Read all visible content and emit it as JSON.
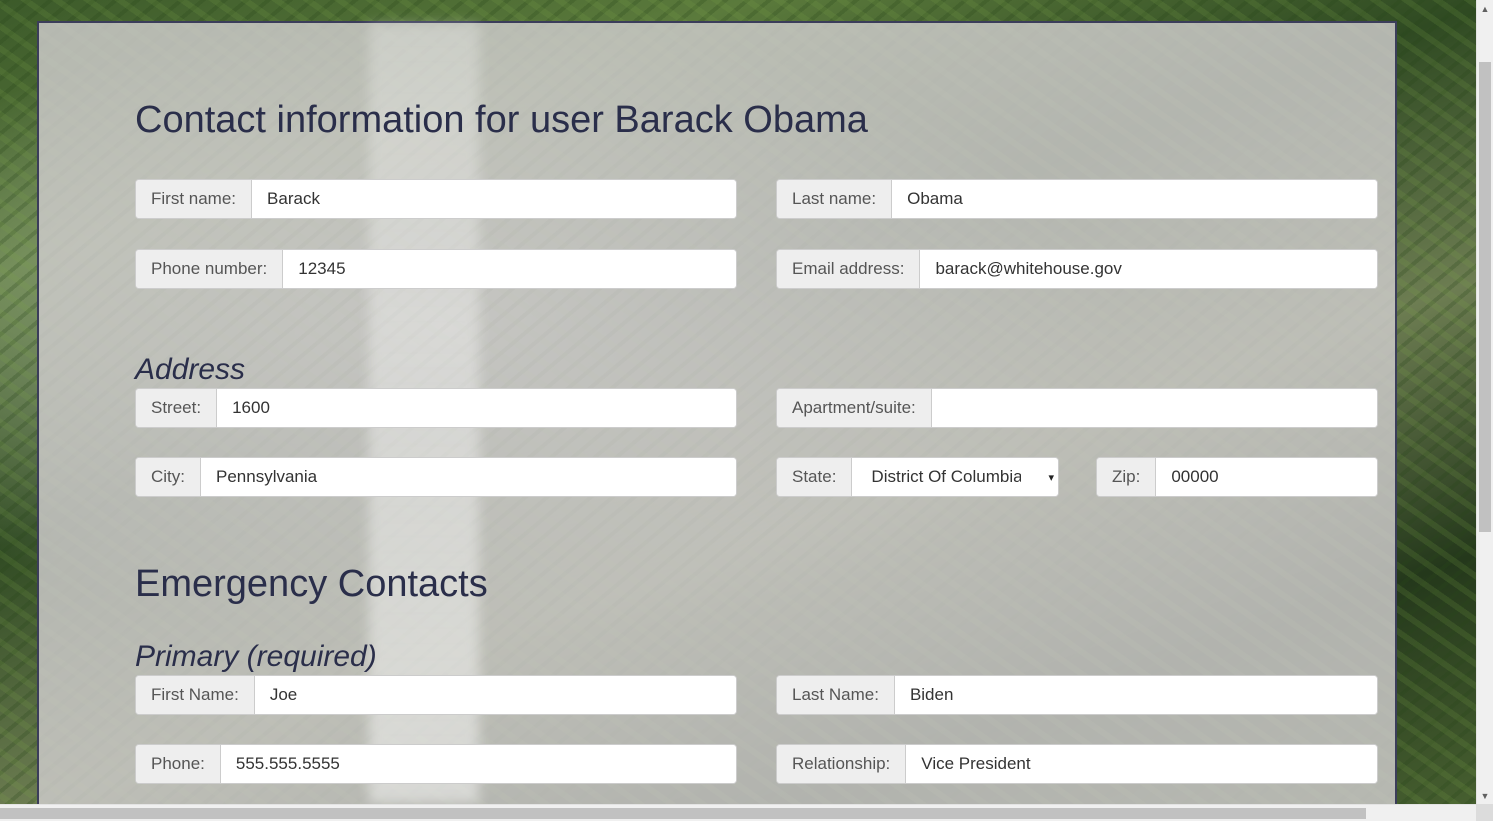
{
  "page": {
    "title": "Contact information for user Barack Obama"
  },
  "contact": {
    "first_name_label": "First name:",
    "first_name_value": "Barack",
    "last_name_label": "Last name:",
    "last_name_value": "Obama",
    "phone_label": "Phone number:",
    "phone_value": "12345",
    "email_label": "Email address:",
    "email_value": "barack@whitehouse.gov"
  },
  "address": {
    "heading": "Address",
    "street_label": "Street:",
    "street_value": "1600",
    "apt_label": "Apartment/suite:",
    "apt_value": "",
    "city_label": "City:",
    "city_value": "Pennsylvania",
    "state_label": "State:",
    "state_value": "District Of Columbia",
    "zip_label": "Zip:",
    "zip_value": "00000"
  },
  "emergency": {
    "heading": "Emergency Contacts",
    "primary_heading": "Primary (required)",
    "first_name_label": "First Name:",
    "first_name_value": "Joe",
    "last_name_label": "Last Name:",
    "last_name_value": "Biden",
    "phone_label": "Phone:",
    "phone_value": "555.555.5555",
    "relationship_label": "Relationship:",
    "relationship_value": "Vice President"
  },
  "icons": {
    "select_caret": "▾",
    "scroll_up": "▲",
    "scroll_down": "▼"
  },
  "colors": {
    "heading_text": "#2a2e4a",
    "panel_border": "#3b3d5a",
    "addon_background": "#eeeeee"
  }
}
